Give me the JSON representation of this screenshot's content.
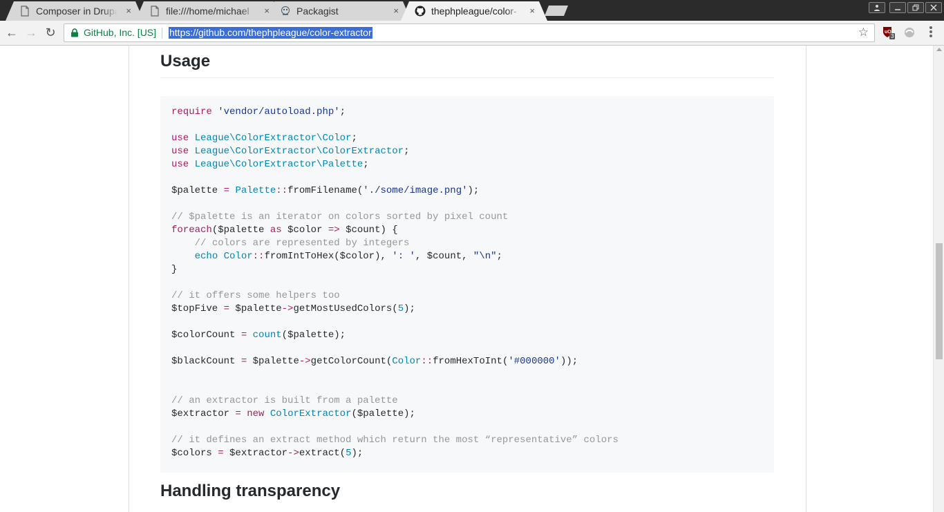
{
  "tabs": [
    {
      "title": "Composer in Drupal",
      "close": "×",
      "icon": "page-icon"
    },
    {
      "title": "file:///home/michael",
      "close": "×",
      "icon": "page-icon"
    },
    {
      "title": "Packagist",
      "close": "×",
      "icon": "packagist-icon"
    },
    {
      "title": "thephpleague/color-",
      "close": "×",
      "icon": "github-icon",
      "active": true
    }
  ],
  "toolbar": {
    "back": "←",
    "forward": "→",
    "reload": "↻",
    "site_identity": "GitHub, Inc. [US]",
    "url": "https://github.com/thephpleague/color-extractor",
    "star": "☆",
    "extension_badge": "3"
  },
  "page": {
    "usage_heading": "Usage",
    "next_heading": "Handling transparency",
    "code": {
      "require_kw": "require",
      "require_str": "'vendor/autoload.php'",
      "use_kw": "use",
      "use_lines": [
        "League\\ColorExtractor\\Color",
        "League\\ColorExtractor\\ColorExtractor",
        "League\\ColorExtractor\\Palette"
      ],
      "comment_iterator": "// $palette is an iterator on colors sorted by pixel count",
      "comment_integers": "// colors are represented by integers",
      "comment_helpers": "// it offers some helpers too",
      "comment_extractor": "// an extractor is built from a palette",
      "comment_extract": "// it defines an extract method which return the most “representative” colors",
      "image_path": "'./some/image.png'",
      "hex_value": "'#000000'",
      "separator_str": "': '",
      "newline_str": "\"\\n\"",
      "top_count": "5",
      "extract_count": "5"
    }
  },
  "colors": {
    "keyword": "#a71d5d",
    "string": "#183691",
    "namespace": "#0086b3",
    "comment": "#969896",
    "url_highlight": "#3b6dd6",
    "secure": "#0b8043"
  }
}
